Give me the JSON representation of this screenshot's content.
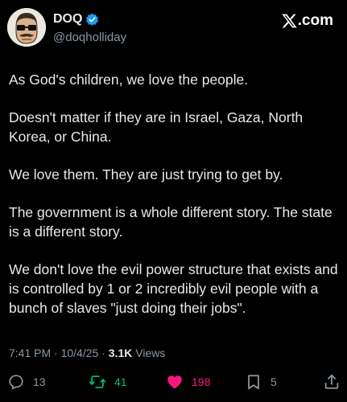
{
  "user": {
    "display_name": "DOQ",
    "handle": "@doqholliday",
    "verified": true,
    "avatar": "cartoon-face-with-sunglasses-and-mustache"
  },
  "brand": {
    "label": ".com",
    "icon": "x-logo-icon"
  },
  "tweet": {
    "paragraphs": [
      "As God's children, we love the people.",
      "Doesn't matter if they are in Israel, Gaza, North Korea, or China.",
      "We love them. They are just trying to get by.",
      "The government is a whole different story. The state is a different story.",
      "We don't love the evil power structure that exists and is controlled by 1 or 2 incredibly evil people with a bunch of slaves \"just doing their jobs\"."
    ]
  },
  "meta": {
    "time": "7:41 PM",
    "separator": "·",
    "date": "10/4/25",
    "views_count": "3.1K",
    "views_label": "Views"
  },
  "actions": {
    "reply": {
      "icon": "reply-icon",
      "count": "13"
    },
    "retweet": {
      "icon": "retweet-icon",
      "count": "41"
    },
    "like": {
      "icon": "heart-icon",
      "count": "198"
    },
    "bookmark": {
      "icon": "bookmark-icon",
      "count": "5"
    },
    "share": {
      "icon": "share-icon"
    }
  },
  "colors": {
    "background": "#000000",
    "text": "#e7e9ea",
    "muted": "#8b98a5",
    "verified": "#1d9bf0",
    "retweet": "#00ba7c",
    "like": "#f91880"
  }
}
